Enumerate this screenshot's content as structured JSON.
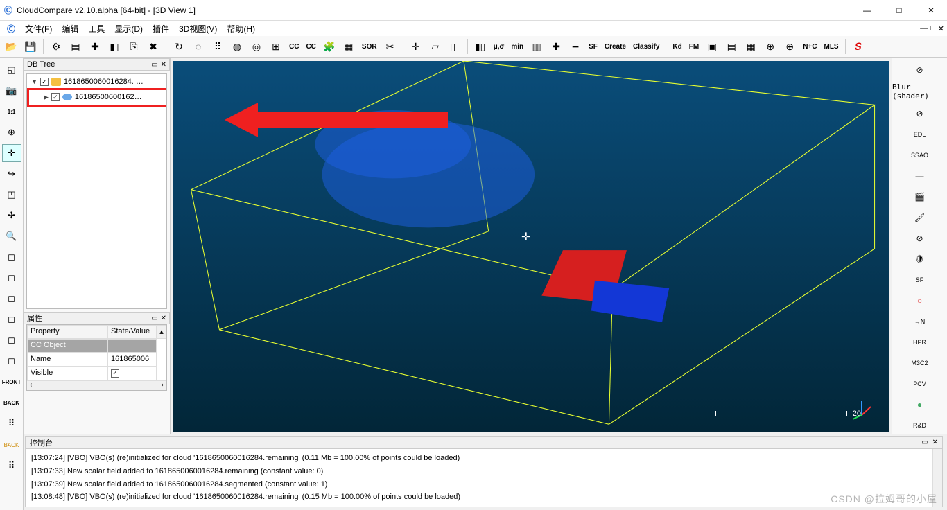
{
  "title": "CloudCompare v2.10.alpha [64-bit] - [3D View 1]",
  "menus": [
    "文件(F)",
    "编辑",
    "工具",
    "显示(D)",
    "插件",
    "3D视图(V)",
    "帮助(H)"
  ],
  "win_sub": [
    "—",
    "□",
    "✕"
  ],
  "toolbar": [
    {
      "t": "icon",
      "g": "📂",
      "n": "open"
    },
    {
      "t": "icon",
      "g": "💾",
      "n": "save"
    },
    {
      "t": "sep"
    },
    {
      "t": "icon",
      "g": "⚙",
      "n": "gear"
    },
    {
      "t": "icon",
      "g": "▤",
      "n": "list"
    },
    {
      "t": "icon",
      "g": "✚",
      "n": "plus-red"
    },
    {
      "t": "icon",
      "g": "◧",
      "n": "color-scale"
    },
    {
      "t": "icon",
      "g": "⎘",
      "n": "export"
    },
    {
      "t": "icon",
      "g": "✖",
      "n": "delete"
    },
    {
      "t": "sep"
    },
    {
      "t": "icon",
      "g": "↻",
      "n": "sphere"
    },
    {
      "t": "icon",
      "g": "◌",
      "n": "cioud"
    },
    {
      "t": "icon",
      "g": "⠿",
      "n": "points"
    },
    {
      "t": "icon",
      "g": "◍",
      "n": "mesh1"
    },
    {
      "t": "icon",
      "g": "◎",
      "n": "mesh2"
    },
    {
      "t": "icon",
      "g": "⊞",
      "n": "grid"
    },
    {
      "t": "txt",
      "g": "CC",
      "n": "cc1"
    },
    {
      "t": "txt",
      "g": "CC",
      "n": "cc2"
    },
    {
      "t": "icon",
      "g": "🧩",
      "n": "plugin"
    },
    {
      "t": "icon",
      "g": "▦",
      "n": "checker"
    },
    {
      "t": "txt",
      "g": "SOR",
      "n": "sor"
    },
    {
      "t": "icon",
      "g": "✂",
      "n": "cut"
    },
    {
      "t": "sep"
    },
    {
      "t": "icon",
      "g": "✛",
      "n": "cross"
    },
    {
      "t": "icon",
      "g": "▱",
      "n": "plane"
    },
    {
      "t": "icon",
      "g": "◫",
      "n": "section"
    },
    {
      "t": "sep"
    },
    {
      "t": "icon",
      "g": "▮▯",
      "n": "hist"
    },
    {
      "t": "txt",
      "g": "μ,σ",
      "n": "stat"
    },
    {
      "t": "txt",
      "g": "min",
      "n": "minmax"
    },
    {
      "t": "icon",
      "g": "▥",
      "n": "gradient"
    },
    {
      "t": "icon",
      "g": "✚",
      "n": "add"
    },
    {
      "t": "icon",
      "g": "━",
      "n": "minus"
    },
    {
      "t": "txt",
      "g": "SF",
      "n": "sf"
    },
    {
      "t": "txt",
      "g": "Create",
      "n": "canupo1"
    },
    {
      "t": "txt",
      "g": "Classify",
      "n": "canupo2"
    },
    {
      "t": "sep"
    },
    {
      "t": "txt",
      "g": "Kd",
      "n": "kd"
    },
    {
      "t": "txt",
      "g": "FM",
      "n": "fm"
    },
    {
      "t": "icon",
      "g": "▣",
      "n": "shp"
    },
    {
      "t": "icon",
      "g": "▤",
      "n": "csv"
    },
    {
      "t": "icon",
      "g": "▦",
      "n": "ras"
    },
    {
      "t": "icon",
      "g": "⊕",
      "n": "globe1"
    },
    {
      "t": "icon",
      "g": "⊕",
      "n": "globe2"
    },
    {
      "t": "txt",
      "g": "N+C",
      "n": "nc"
    },
    {
      "t": "txt",
      "g": "MLS",
      "n": "mls"
    },
    {
      "t": "sep"
    },
    {
      "t": "icon",
      "g": "𝑺",
      "n": "s-red",
      "c": "#d00"
    }
  ],
  "lefttools": [
    {
      "g": "◱",
      "n": "fullscreen"
    },
    {
      "g": "📷",
      "n": "snapshot"
    },
    {
      "g": "1:1",
      "n": "scale-11",
      "txt": true
    },
    {
      "g": "⊕",
      "n": "center"
    },
    {
      "g": "✛",
      "n": "pick-rot",
      "sel": true,
      "sub": "auto"
    },
    {
      "g": "↪",
      "n": "rotate"
    },
    {
      "g": "◳",
      "n": "fit"
    },
    {
      "g": "✢",
      "n": "translate"
    },
    {
      "g": "🔍",
      "n": "zoom"
    },
    {
      "g": "◻",
      "n": "view-top"
    },
    {
      "g": "◻",
      "n": "view-front1"
    },
    {
      "g": "◻",
      "n": "view-side"
    },
    {
      "g": "◻",
      "n": "view-left"
    },
    {
      "g": "◻",
      "n": "view-right"
    },
    {
      "g": "◻",
      "n": "view-iso"
    },
    {
      "g": "FRONT",
      "n": "view-front",
      "txt": true
    },
    {
      "g": "BACK",
      "n": "view-back",
      "txt": true
    },
    {
      "g": "⠿",
      "n": "view-custom"
    }
  ],
  "dbtree": {
    "title": "DB Tree",
    "rows": [
      {
        "exp": "▼",
        "label": "1618650060016284. …",
        "icon": "folder"
      },
      {
        "exp": "▶",
        "label": "16186500600162…",
        "icon": "cloud"
      }
    ]
  },
  "props": {
    "title": "属性",
    "cols": [
      "Property",
      "State/Value"
    ],
    "rows": [
      {
        "k": "CC Object",
        "v": "",
        "sel": true
      },
      {
        "k": "Name",
        "v": "161865006"
      },
      {
        "k": "Visible",
        "v": "check"
      }
    ]
  },
  "rightpanel": {
    "label": "Blur (shader)",
    "items": [
      {
        "g": "⊘",
        "n": "blur-none"
      },
      {
        "g": "EDL",
        "n": "edl",
        "txt": true
      },
      {
        "g": "SSAO",
        "n": "ssao",
        "txt": true
      },
      {
        "g": "—",
        "n": "rsep"
      },
      {
        "g": "🎬",
        "n": "anim"
      },
      {
        "g": "🖌",
        "n": "brush"
      },
      {
        "g": "⊘",
        "n": "compass"
      },
      {
        "g": "🛡",
        "n": "shield"
      },
      {
        "g": "SF",
        "n": "sf-blue",
        "txt": true
      },
      {
        "g": "○",
        "n": "ellipse",
        "c": "#d33"
      },
      {
        "g": "→N",
        "n": "normal",
        "txt": true
      },
      {
        "g": "HPR",
        "n": "hpr",
        "txt": true
      },
      {
        "g": "M3C2",
        "n": "m3c2",
        "txt": true
      },
      {
        "g": "PCV",
        "n": "pcv",
        "txt": true
      },
      {
        "g": "●",
        "n": "stone",
        "c": "#4a6"
      },
      {
        "g": "R&D",
        "n": "rnd",
        "txt": true
      }
    ]
  },
  "console": {
    "title": "控制台",
    "lines": [
      "[13:07:24] [VBO] VBO(s) (re)initialized for cloud '1618650060016284.remaining' (0.11 Mb = 100.00% of points could be loaded)",
      "[13:07:33] New scalar field added to 1618650060016284.remaining (constant value: 0)",
      "[13:07:39] New scalar field added to 1618650060016284.segmented (constant value: 1)",
      "[13:08:48] [VBO] VBO(s) (re)initialized for cloud '1618650060016284.remaining' (0.15 Mb = 100.00% of points could be loaded)"
    ]
  },
  "scale_value": "20",
  "watermark": "CSDN @拉姆哥的小屋"
}
